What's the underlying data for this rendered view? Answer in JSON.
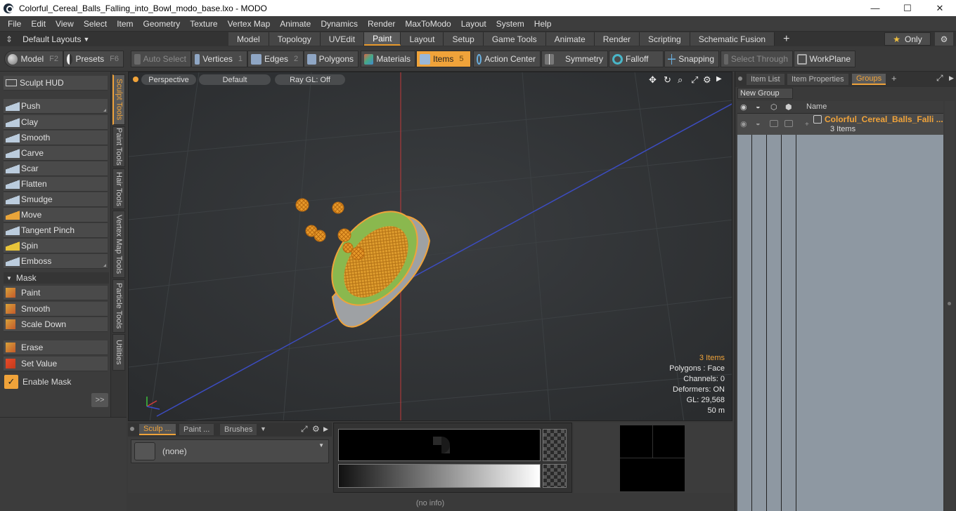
{
  "window": {
    "title": "Colorful_Cereal_Balls_Falling_into_Bowl_modo_base.lxo - MODO",
    "minimize": "—",
    "maximize": "☐",
    "close": "✕"
  },
  "menu": [
    "File",
    "Edit",
    "View",
    "Select",
    "Item",
    "Geometry",
    "Texture",
    "Vertex Map",
    "Animate",
    "Dynamics",
    "Render",
    "MaxToModo",
    "Layout",
    "System",
    "Help"
  ],
  "layouts": {
    "label": "Default Layouts",
    "tabs": [
      "Model",
      "Topology",
      "UVEdit",
      "Paint",
      "Layout",
      "Setup",
      "Game Tools",
      "Animate",
      "Render",
      "Scripting",
      "Schematic Fusion"
    ],
    "active_tab": "Paint",
    "add": "+",
    "only_label": "Only",
    "star": "★"
  },
  "toolbar": {
    "model": "Model",
    "model_key": "F2",
    "presets": "Presets",
    "presets_key": "F6",
    "auto_select": "Auto Select",
    "vertices": "Vertices",
    "vertices_key": "1",
    "edges": "Edges",
    "edges_key": "2",
    "polygons": "Polygons",
    "materials": "Materials",
    "items": "Items",
    "items_key": "5",
    "action_center": "Action Center",
    "symmetry": "Symmetry",
    "falloff": "Falloff",
    "snapping": "Snapping",
    "select_through": "Select Through",
    "workplane": "WorkPlane"
  },
  "sculpt": {
    "hud": "Sculpt HUD",
    "tools": [
      "Push",
      "Clay",
      "Smooth",
      "Carve",
      "Scar",
      "Flatten",
      "Smudge",
      "Move",
      "Tangent Pinch",
      "Spin",
      "Emboss"
    ],
    "mask_header": "Mask",
    "mask_tools": [
      "Paint",
      "Smooth",
      "Scale Down"
    ],
    "extra_tools": [
      "Erase",
      "Set Value"
    ],
    "enable_mask": "Enable Mask",
    "more": ">>"
  },
  "vtabs": [
    "Sculpt Tools",
    "Paint Tools",
    "Hair Tools",
    "Vertex Map Tools",
    "Particle Tools",
    "Utilities"
  ],
  "viewport": {
    "view": "Perspective",
    "style": "Default",
    "raygl": "Ray GL: Off",
    "info": {
      "items": "3 Items",
      "polygons": "Polygons : Face",
      "channels": "Channels: 0",
      "deformers": "Deformers: ON",
      "gl": "GL: 29,568",
      "distance": "50 m"
    }
  },
  "bottom": {
    "tabs": [
      "Sculp ...",
      "Paint ...",
      "Brushes"
    ],
    "brush_value": "(none)",
    "status": "(no info)"
  },
  "rightpanel": {
    "tabs": [
      "Item List",
      "Item Properties",
      "Groups"
    ],
    "active_tab": "Groups",
    "add": "+",
    "new_group": "New Group",
    "col_name": "Name",
    "group_name": "Colorful_Cereal_Balls_Falli ...",
    "group_count": "3 Items"
  },
  "colors": {
    "accent": "#f0a33a",
    "viewport_bg": "#2f3234",
    "bowl_inner": "#7fb34a",
    "wire": "#f0a33a"
  }
}
